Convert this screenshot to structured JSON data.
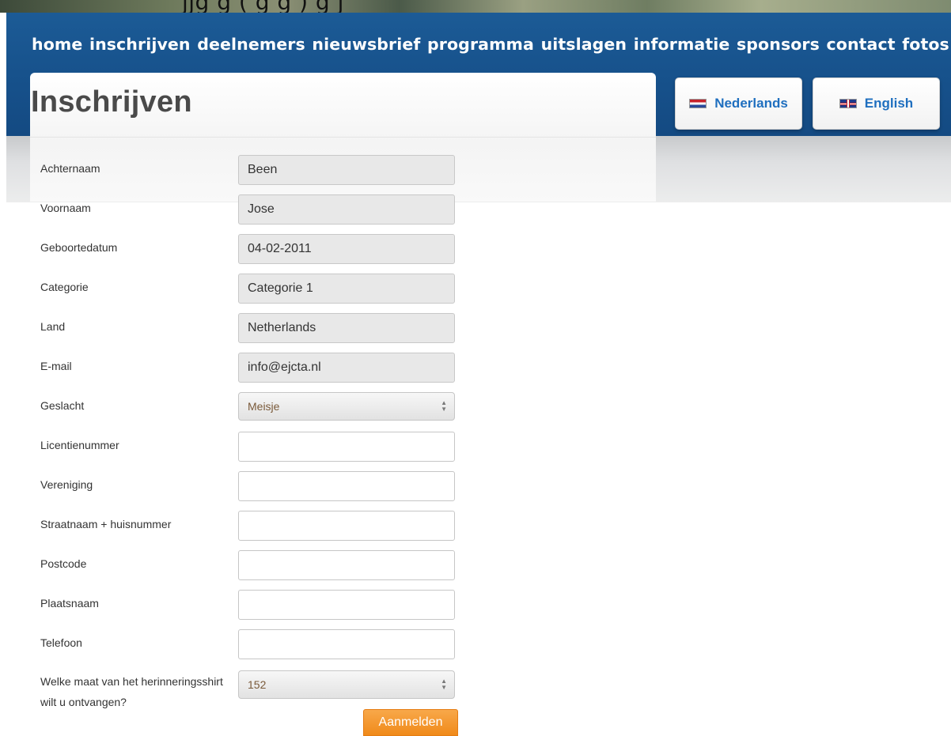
{
  "header": {
    "strip_text": "jjg  g  (          g    g  )     g j",
    "nav": [
      "home",
      "inschrijven",
      "deelnemers",
      "nieuwsbrief",
      "programma",
      "uitslagen",
      "informatie",
      "sponsors",
      "contact",
      "fotos"
    ]
  },
  "page": {
    "title": "Inschrijven"
  },
  "languages": {
    "nl": "Nederlands",
    "en": "English"
  },
  "form": {
    "fields": [
      {
        "label": "Achternaam",
        "value": "Been"
      },
      {
        "label": "Voornaam",
        "value": "Jose"
      },
      {
        "label": "Geboortedatum",
        "value": "04-02-2011"
      },
      {
        "label": "Categorie",
        "value": "Categorie 1"
      },
      {
        "label": "Land",
        "value": "Netherlands"
      },
      {
        "label": "E-mail",
        "value": "info@ejcta.nl"
      },
      {
        "label": "Geslacht",
        "value": "Meisje"
      },
      {
        "label": "Licentienummer",
        "value": ""
      },
      {
        "label": "Vereniging",
        "value": ""
      },
      {
        "label": "Straatnaam + huisnummer",
        "value": ""
      },
      {
        "label": "Postcode",
        "value": ""
      },
      {
        "label": "Plaatsnaam",
        "value": ""
      },
      {
        "label": "Telefoon",
        "value": ""
      },
      {
        "label": "Welke maat van het herinneringsshirt wilt u ontvangen?",
        "value": "152"
      }
    ],
    "submit_label": "Aanmelden"
  },
  "colors": {
    "header_blue": "#16508a",
    "link_blue": "#1f6fbf",
    "submit_orange": "#f08a1a"
  }
}
